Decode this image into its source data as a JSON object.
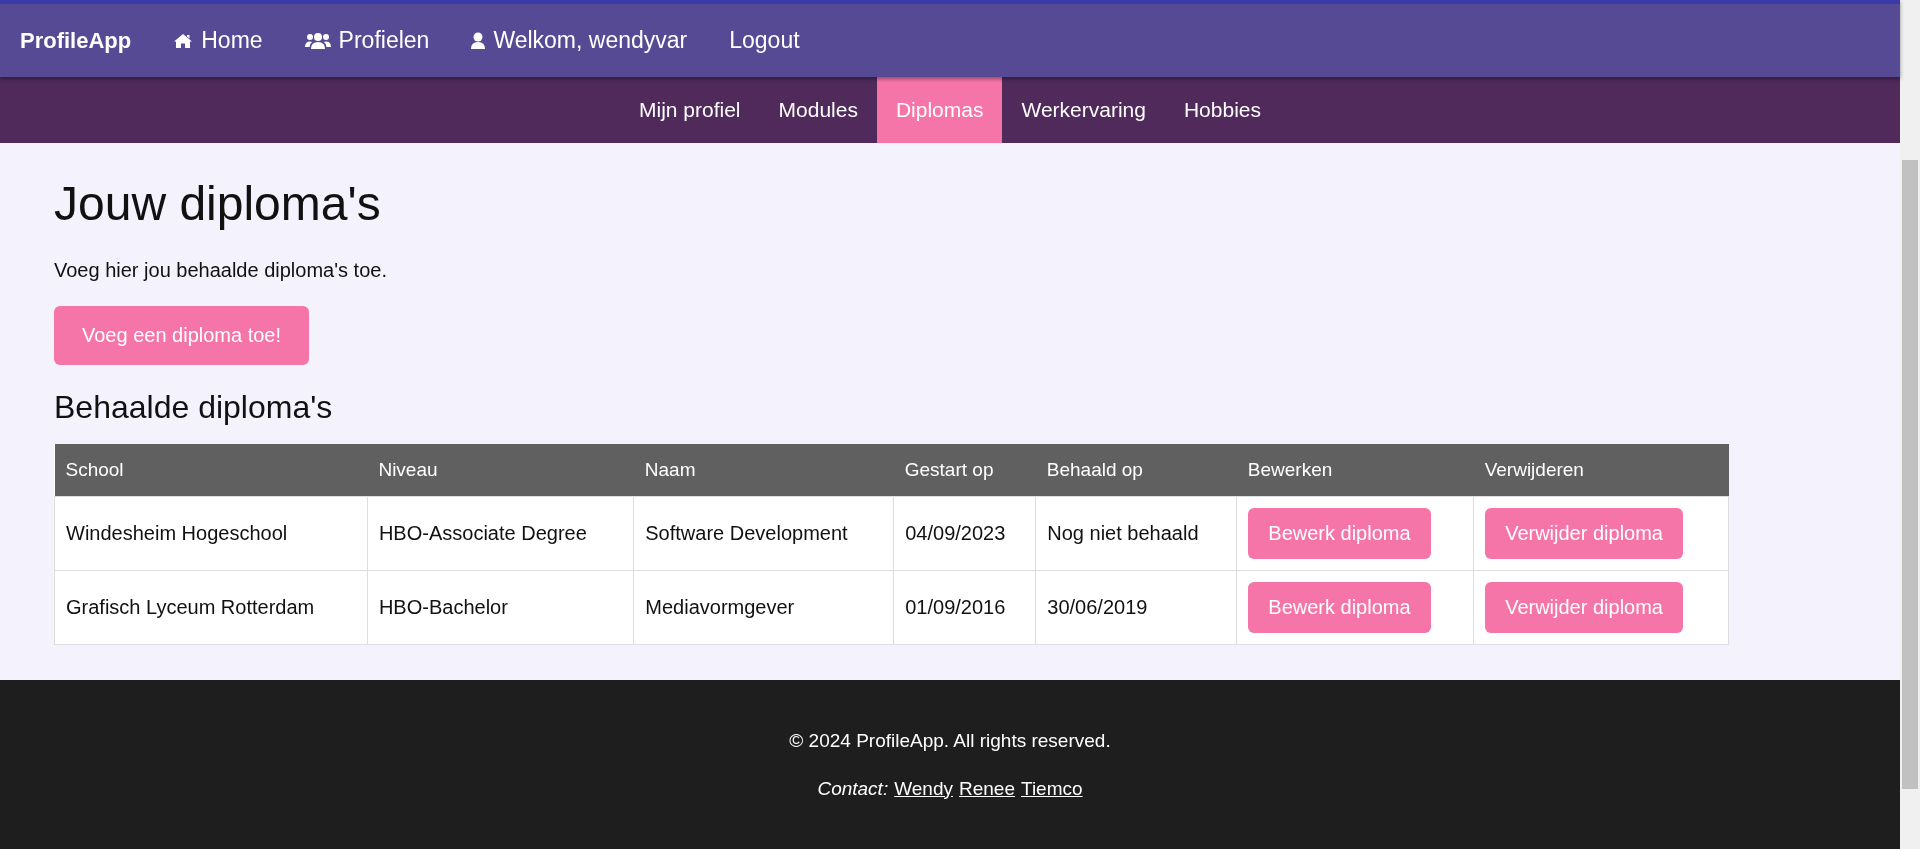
{
  "navbar": {
    "brand": "ProfileApp",
    "items": [
      {
        "label": "Home",
        "kind": "home"
      },
      {
        "label": "Profielen",
        "kind": "group"
      },
      {
        "label": "Welkom, wendyvar",
        "kind": "account"
      },
      {
        "label": "Logout",
        "kind": "plain"
      }
    ]
  },
  "subnav": {
    "tabs": [
      {
        "label": "Mijn profiel",
        "selected": false
      },
      {
        "label": "Modules",
        "selected": false
      },
      {
        "label": "Diplomas",
        "selected": true
      },
      {
        "label": "Werkervaring",
        "selected": false
      },
      {
        "label": "Hobbies",
        "selected": false
      }
    ]
  },
  "main": {
    "title": "Jouw diploma's",
    "intro": "Voeg hier jou behaalde diploma's toe.",
    "add_button": "Voeg een diploma toe!",
    "table_title": "Behaalde diploma's"
  },
  "table": {
    "columns": [
      "School",
      "Niveau",
      "Naam",
      "Gestart op",
      "Behaald op",
      "Bewerken",
      "Verwijderen"
    ],
    "rows": [
      {
        "school": "Windesheim Hogeschool",
        "niveau": "HBO-Associate Degree",
        "naam": "Software Development",
        "gestart": "04/09/2023",
        "behaald": "Nog niet behaald",
        "edit": "Bewerk diploma",
        "delete": "Verwijder diploma"
      },
      {
        "school": "Grafisch Lyceum Rotterdam",
        "niveau": "HBO-Bachelor",
        "naam": "Mediavormgever",
        "gestart": "01/09/2016",
        "behaald": "30/06/2019",
        "edit": "Bewerk diploma",
        "delete": "Verwijder diploma"
      }
    ]
  },
  "footer": {
    "copyright": "© 2024 ProfileApp. All rights reserved.",
    "contact_label": "Contact:",
    "contact_links": [
      "Wendy",
      "Renee",
      "Tiemco"
    ]
  }
}
